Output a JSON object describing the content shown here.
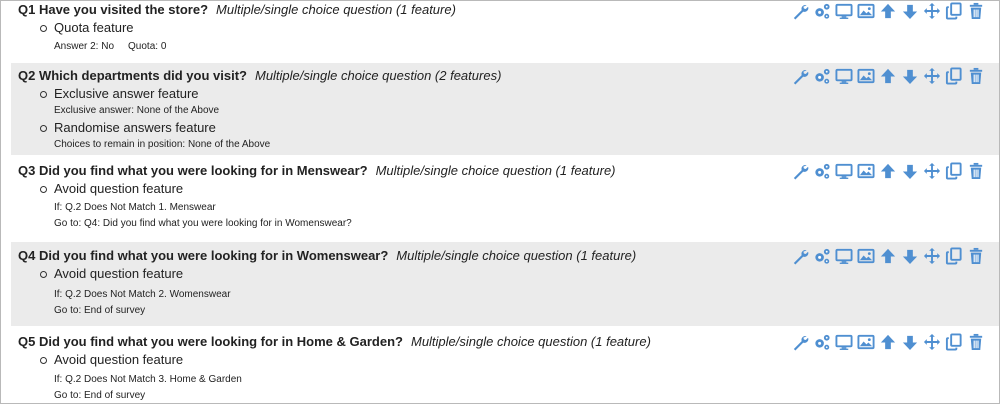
{
  "questions": [
    {
      "title": "Q1 Have you visited the store?",
      "type": "Multiple/single choice question (1 feature)",
      "features": [
        {
          "name": "Quota feature",
          "details": [
            [
              "Answer 2: No",
              "Quota: 0"
            ]
          ]
        }
      ]
    },
    {
      "title": "Q2 Which departments did you visit?",
      "type": "Multiple/single choice question (2 features)",
      "features": [
        {
          "name": "Exclusive answer feature",
          "details": [
            [
              "Exclusive answer: None of the Above"
            ]
          ]
        },
        {
          "name": "Randomise answers feature",
          "details": [
            [
              "Choices to remain in position: None of the Above"
            ]
          ]
        }
      ]
    },
    {
      "title": "Q3 Did you find what you were looking for in Menswear?",
      "type": "Multiple/single choice question (1 feature)",
      "features": [
        {
          "name": "Avoid question feature",
          "details": [
            [
              "If: Q.2 Does Not Match 1. Menswear"
            ],
            [
              "Go to: Q4: Did you find what you were looking for in Womenswear?"
            ]
          ]
        }
      ]
    },
    {
      "title": "Q4 Did you find what you were looking for in Womenswear?",
      "type": "Multiple/single choice question (1 feature)",
      "features": [
        {
          "name": "Avoid question feature",
          "details": [
            [
              "If: Q.2 Does Not Match 2. Womenswear"
            ],
            [
              "Go to: End of survey"
            ]
          ]
        }
      ]
    },
    {
      "title": "Q5 Did you find what you were looking for in Home & Garden?",
      "type": "Multiple/single choice question (1 feature)",
      "features": [
        {
          "name": "Avoid question feature",
          "details": [
            [
              "If: Q.2 Does Not Match 3. Home & Garden"
            ],
            [
              "Go to: End of survey"
            ]
          ]
        }
      ]
    }
  ],
  "toolbar_icons": [
    "wrench-icon",
    "gears-icon",
    "monitor-icon",
    "image-icon",
    "arrow-up-icon",
    "arrow-down-icon",
    "move-icon",
    "copy-icon",
    "trash-icon"
  ],
  "colors": {
    "icon": "#4f8fd1",
    "shaded_row": "#ebebeb",
    "border": "#b9b9b9"
  }
}
